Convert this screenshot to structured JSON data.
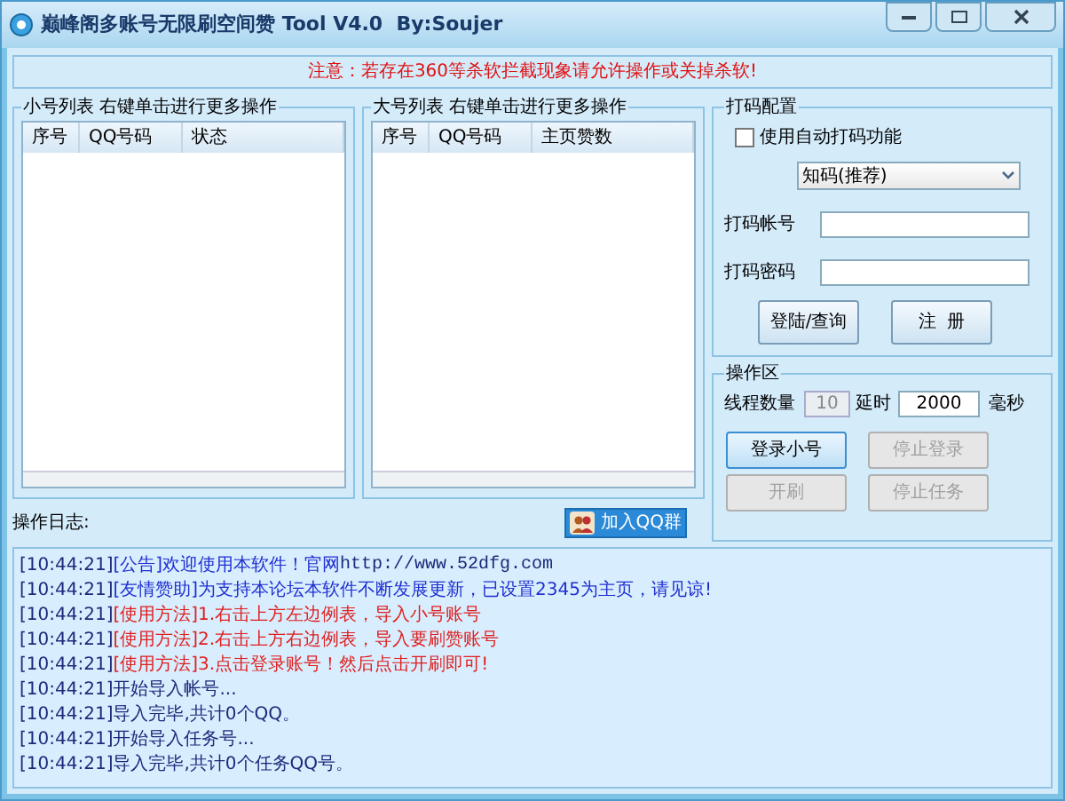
{
  "window": {
    "title": "巅峰阁多账号无限刷空间赞 Tool V4.0  By:Soujer"
  },
  "notice": "注意：若存在360等杀软拦截现象请允许操作或关掉杀软!",
  "small_list": {
    "title": "小号列表   右键单击进行更多操作",
    "columns": [
      "序号",
      "QQ号码",
      "状态"
    ]
  },
  "big_list": {
    "title": "大号列表   右键单击进行更多操作",
    "columns": [
      "序号",
      "QQ号码",
      "主页赞数"
    ]
  },
  "captcha": {
    "title": "打码配置",
    "auto_checkbox": {
      "label": "使用自动打码功能",
      "checked": false
    },
    "service": "知码(推荐)",
    "account": {
      "label": "打码帐号"
    },
    "password": {
      "label": "打码密码"
    },
    "buttons": [
      {
        "label": "登陆/查询",
        "disabled": false
      },
      {
        "label": "注  册",
        "disabled": false
      }
    ]
  },
  "operations": {
    "title": "操作区",
    "threads_label": "线程数量",
    "threads": "10",
    "delay_label": "延时",
    "delay": "2000",
    "unit": "毫秒",
    "buttons": [
      {
        "label": "登录小号",
        "disabled": false,
        "focused": true
      },
      {
        "label": "停止登录",
        "disabled": true,
        "focused": false
      },
      {
        "label": "开刷",
        "disabled": true,
        "focused": false
      },
      {
        "label": "停止任务",
        "disabled": true,
        "focused": false
      }
    ]
  },
  "log_label": "操作日志:",
  "qq_group_button": "加入QQ群",
  "log": [
    {
      "time": "[10:44:21]",
      "text": "[公告]欢迎使用本软件！官网",
      "url": "http://www.52dfg.com",
      "color": "#1f2fd0"
    },
    {
      "time": "[10:44:21]",
      "text": "[友情赞助]为支持本论坛本软件不断发展更新，已设置2345为主页，请见谅!",
      "color": "#1f2fd0"
    },
    {
      "time": "[10:44:21]",
      "text": "[使用方法]1.右击上方左边例表，导入小号账号",
      "color": "#e02020"
    },
    {
      "time": "[10:44:21]",
      "text": "[使用方法]2.右击上方右边例表，导入要刷赞账号",
      "color": "#e02020"
    },
    {
      "time": "[10:44:21]",
      "text": "[使用方法]3.点击登录账号！然后点击开刷即可!",
      "color": "#e02020"
    },
    {
      "time": "[10:44:21]",
      "text": "开始导入帐号...",
      "color": "#1a2a7a"
    },
    {
      "time": "[10:44:21]",
      "text": "导入完毕,共计0个QQ。",
      "color": "#1a2a7a"
    },
    {
      "time": "[10:44:21]",
      "text": "开始导入任务号...",
      "color": "#1a2a7a"
    },
    {
      "time": "[10:44:21]",
      "text": "导入完毕,共计0个任务QQ号。",
      "color": "#1a2a7a"
    }
  ]
}
